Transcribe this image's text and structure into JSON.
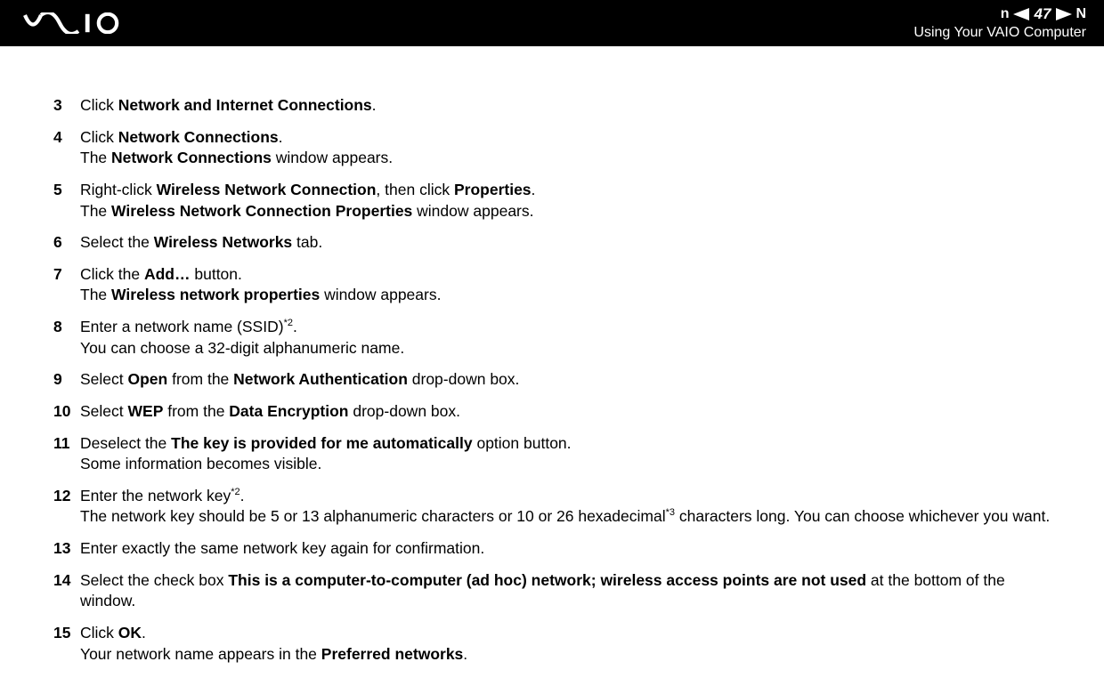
{
  "header": {
    "page_number": "47",
    "n_label": "n",
    "big_n": "N",
    "section_title": "Using Your VAIO Computer"
  },
  "steps": {
    "s3": {
      "num": "3",
      "a": "Click ",
      "b": "Network and Internet Connections",
      "c": "."
    },
    "s4": {
      "num": "4",
      "a": "Click ",
      "b": "Network Connections",
      "c": ".",
      "d": "The ",
      "e": "Network Connections",
      "f": " window appears."
    },
    "s5": {
      "num": "5",
      "a": "Right-click ",
      "b": "Wireless Network Connection",
      "c": ", then click ",
      "d": "Properties",
      "e": ".",
      "f": "The ",
      "g": "Wireless Network Connection Properties",
      "h": " window appears."
    },
    "s6": {
      "num": "6",
      "a": "Select the ",
      "b": "Wireless Networks",
      "c": " tab."
    },
    "s7": {
      "num": "7",
      "a": "Click the ",
      "b": "Add…",
      "c": " button.",
      "d": "The ",
      "e": "Wireless network properties",
      "f": " window appears."
    },
    "s8": {
      "num": "8",
      "a": "Enter a network name (SSID)",
      "sup": "*2",
      "b": ".",
      "c": "You can choose a 32-digit alphanumeric name."
    },
    "s9": {
      "num": "9",
      "a": "Select ",
      "b": "Open",
      "c": " from the ",
      "d": "Network Authentication",
      "e": " drop-down box."
    },
    "s10": {
      "num": "10",
      "a": "Select ",
      "b": "WEP",
      "c": " from the ",
      "d": "Data Encryption",
      "e": " drop-down box."
    },
    "s11": {
      "num": "11",
      "a": "Deselect the ",
      "b": "The key is provided for me automatically",
      "c": " option button.",
      "d": "Some information becomes visible."
    },
    "s12": {
      "num": "12",
      "a": "Enter the network key",
      "sup": "*2",
      "b": ".",
      "c": "The network key should be 5 or 13 alphanumeric characters or 10 or 26 hexadecimal",
      "sup2": "*3",
      "d": " characters long. You can choose whichever you want."
    },
    "s13": {
      "num": "13",
      "a": "Enter exactly the same network key again for confirmation."
    },
    "s14": {
      "num": "14",
      "a": "Select the check box ",
      "b": "This is a computer-to-computer (ad hoc) network; wireless access points are not used",
      "c": " at the bottom of the window."
    },
    "s15": {
      "num": "15",
      "a": "Click ",
      "b": "OK",
      "c": ".",
      "d": "Your network name appears in the ",
      "e": "Preferred networks",
      "f": "."
    }
  }
}
